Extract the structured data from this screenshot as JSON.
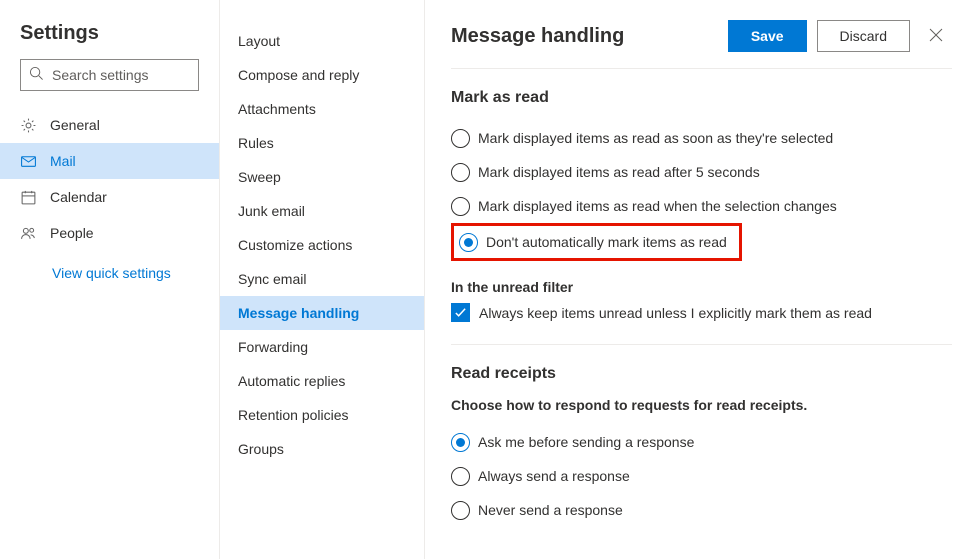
{
  "left": {
    "title": "Settings",
    "search_placeholder": "Search settings",
    "categories": [
      {
        "id": "general",
        "label": "General"
      },
      {
        "id": "mail",
        "label": "Mail"
      },
      {
        "id": "calendar",
        "label": "Calendar"
      },
      {
        "id": "people",
        "label": "People"
      }
    ],
    "selected_category": "mail",
    "quick_link": "View quick settings"
  },
  "mid": {
    "items": [
      "Layout",
      "Compose and reply",
      "Attachments",
      "Rules",
      "Sweep",
      "Junk email",
      "Customize actions",
      "Sync email",
      "Message handling",
      "Forwarding",
      "Automatic replies",
      "Retention policies",
      "Groups"
    ],
    "selected": "Message handling"
  },
  "right": {
    "title": "Message handling",
    "save_label": "Save",
    "discard_label": "Discard",
    "mark_as_read": {
      "heading": "Mark as read",
      "options": [
        "Mark displayed items as read as soon as they're selected",
        "Mark displayed items as read after 5 seconds",
        "Mark displayed items as read when the selection changes",
        "Don't automatically mark items as read"
      ],
      "selected_index": 3,
      "unread_filter_heading": "In the unread filter",
      "unread_checkbox_label": "Always keep items unread unless I explicitly mark them as read",
      "unread_checkbox_checked": true
    },
    "read_receipts": {
      "heading": "Read receipts",
      "help": "Choose how to respond to requests for read receipts.",
      "options": [
        "Ask me before sending a response",
        "Always send a response",
        "Never send a response"
      ],
      "selected_index": 0
    }
  }
}
